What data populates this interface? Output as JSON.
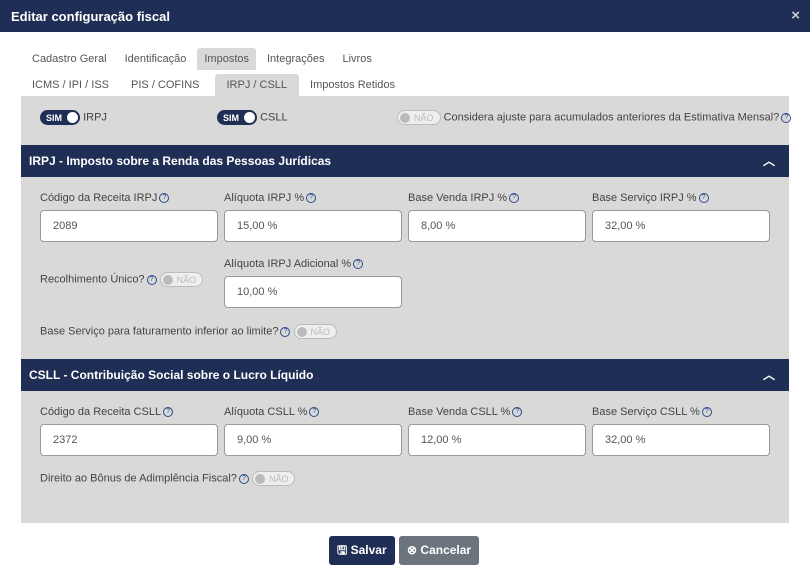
{
  "dialog": {
    "title": "Editar configuração fiscal",
    "close": "×"
  },
  "tabs": [
    "Cadastro Geral",
    "Identificação",
    "Impostos",
    "Integrações",
    "Livros"
  ],
  "subtabs": [
    "ICMS / IPI / ISS",
    "PIS / COFINS",
    "IRPJ / CSLL",
    "Impostos Retidos"
  ],
  "toggles": {
    "irpj": {
      "state": "SIM",
      "label": "IRPJ"
    },
    "csll": {
      "state": "SIM",
      "label": "CSLL"
    },
    "ajuste": {
      "state": "NÃO",
      "label": "Considera ajuste para acumulados anteriores da Estimativa Mensal?"
    }
  },
  "irpj": {
    "title": "IRPJ - Imposto sobre a Renda das Pessoas Jurídicas",
    "fields": [
      {
        "label": "Código da Receita IRPJ",
        "value": "2089"
      },
      {
        "label": "Alíquota IRPJ %",
        "value": "15,00 %"
      },
      {
        "label": "Base Venda IRPJ %",
        "value": "8,00 %"
      },
      {
        "label": "Base Serviço IRPJ %",
        "value": "32,00 %"
      }
    ],
    "recolhimento": {
      "label": "Recolhimento Único?",
      "state": "NÃO"
    },
    "adicional": {
      "label": "Alíquota IRPJ Adicional %",
      "value": "10,00 %"
    },
    "base_servico_limite": {
      "label": "Base Serviço para faturamento inferior ao limite?",
      "state": "NÃO"
    }
  },
  "csll": {
    "title": "CSLL - Contribuição Social sobre o Lucro Líquido",
    "fields": [
      {
        "label": "Código da Receita CSLL",
        "value": "2372"
      },
      {
        "label": "Alíquota CSLL %",
        "value": "9,00 %"
      },
      {
        "label": "Base Venda CSLL %",
        "value": "12,00 %"
      },
      {
        "label": "Base Serviço CSLL %",
        "value": "32,00 %"
      }
    ],
    "bonus": {
      "label": "Direito ao Bônus de Adimplência Fiscal?",
      "state": "NÃO"
    }
  },
  "buttons": {
    "save": "Salvar",
    "cancel": "Cancelar"
  },
  "colors": {
    "primary": "#1f2e55",
    "panel": "#d9d9d9",
    "cancel": "#6c757d"
  }
}
